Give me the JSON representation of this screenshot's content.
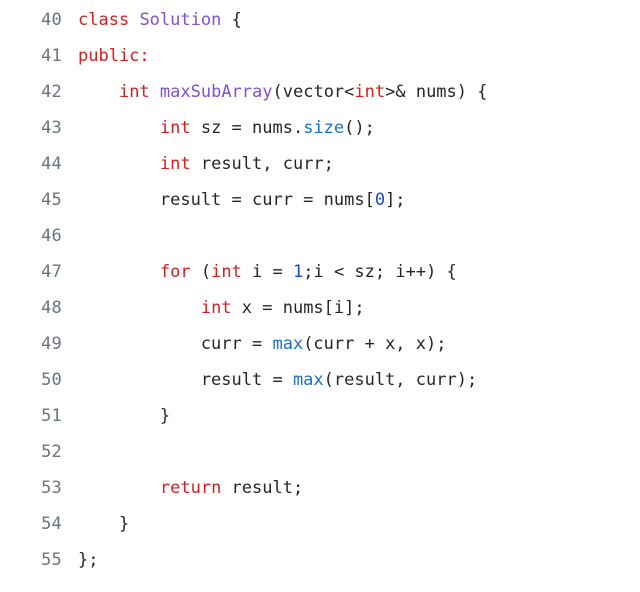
{
  "editor": {
    "language": "cpp",
    "background_color": "#ffffff",
    "first_line_number": 40,
    "last_line_number": 55,
    "gutter_color": "#6b7280",
    "colors": {
      "keyword": "#d32020",
      "type": "#8050d0",
      "function": "#1a6fd0",
      "number": "#1a46d0",
      "plain": "#262626"
    },
    "lines": [
      {
        "number": "40",
        "text": "class Solution {",
        "tokens": [
          {
            "t": "class",
            "c": "keyword"
          },
          {
            "t": " ",
            "c": "plain"
          },
          {
            "t": "Solution",
            "c": "type"
          },
          {
            "t": " {",
            "c": "plain"
          }
        ]
      },
      {
        "number": "41",
        "text": "public:",
        "tokens": [
          {
            "t": "public:",
            "c": "keyword"
          }
        ]
      },
      {
        "number": "42",
        "text": "    int maxSubArray(vector<int>& nums) {",
        "tokens": [
          {
            "t": "    ",
            "c": "plain"
          },
          {
            "t": "int",
            "c": "keyword"
          },
          {
            "t": " ",
            "c": "plain"
          },
          {
            "t": "maxSubArray",
            "c": "type"
          },
          {
            "t": "(vector<",
            "c": "plain"
          },
          {
            "t": "int",
            "c": "keyword"
          },
          {
            "t": ">& nums) {",
            "c": "plain"
          }
        ]
      },
      {
        "number": "43",
        "text": "        int sz = nums.size();",
        "tokens": [
          {
            "t": "        ",
            "c": "plain"
          },
          {
            "t": "int",
            "c": "keyword"
          },
          {
            "t": " sz = nums.",
            "c": "plain"
          },
          {
            "t": "size",
            "c": "function"
          },
          {
            "t": "();",
            "c": "plain"
          }
        ]
      },
      {
        "number": "44",
        "text": "        int result, curr;",
        "tokens": [
          {
            "t": "        ",
            "c": "plain"
          },
          {
            "t": "int",
            "c": "keyword"
          },
          {
            "t": " result, curr;",
            "c": "plain"
          }
        ]
      },
      {
        "number": "45",
        "text": "        result = curr = nums[0];",
        "tokens": [
          {
            "t": "        result = curr = nums[",
            "c": "plain"
          },
          {
            "t": "0",
            "c": "number"
          },
          {
            "t": "];",
            "c": "plain"
          }
        ]
      },
      {
        "number": "46",
        "text": "",
        "tokens": []
      },
      {
        "number": "47",
        "text": "        for (int i = 1;i < sz; i++) {",
        "tokens": [
          {
            "t": "        ",
            "c": "plain"
          },
          {
            "t": "for",
            "c": "keyword"
          },
          {
            "t": " (",
            "c": "plain"
          },
          {
            "t": "int",
            "c": "keyword"
          },
          {
            "t": " i = ",
            "c": "plain"
          },
          {
            "t": "1",
            "c": "number"
          },
          {
            "t": ";i < sz; i++) {",
            "c": "plain"
          }
        ]
      },
      {
        "number": "48",
        "text": "            int x = nums[i];",
        "tokens": [
          {
            "t": "            ",
            "c": "plain"
          },
          {
            "t": "int",
            "c": "keyword"
          },
          {
            "t": " x = nums[i];",
            "c": "plain"
          }
        ]
      },
      {
        "number": "49",
        "text": "            curr = max(curr + x, x);",
        "tokens": [
          {
            "t": "            curr = ",
            "c": "plain"
          },
          {
            "t": "max",
            "c": "function"
          },
          {
            "t": "(curr + x, x);",
            "c": "plain"
          }
        ]
      },
      {
        "number": "50",
        "text": "            result = max(result, curr);",
        "tokens": [
          {
            "t": "            result = ",
            "c": "plain"
          },
          {
            "t": "max",
            "c": "function"
          },
          {
            "t": "(result, curr);",
            "c": "plain"
          }
        ]
      },
      {
        "number": "51",
        "text": "        }",
        "tokens": [
          {
            "t": "        }",
            "c": "plain"
          }
        ]
      },
      {
        "number": "52",
        "text": "",
        "tokens": []
      },
      {
        "number": "53",
        "text": "        return result;",
        "tokens": [
          {
            "t": "        ",
            "c": "plain"
          },
          {
            "t": "return",
            "c": "keyword"
          },
          {
            "t": " result;",
            "c": "plain"
          }
        ]
      },
      {
        "number": "54",
        "text": "    }",
        "tokens": [
          {
            "t": "    }",
            "c": "plain"
          }
        ]
      },
      {
        "number": "55",
        "text": "};",
        "tokens": [
          {
            "t": "};",
            "c": "plain"
          }
        ]
      }
    ]
  }
}
